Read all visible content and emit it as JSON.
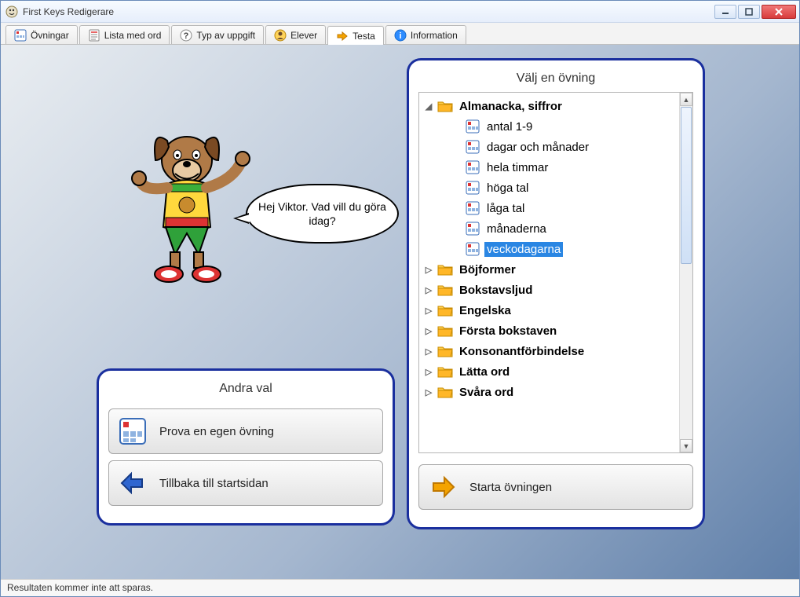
{
  "window": {
    "title": "First Keys Redigerare"
  },
  "tabs": [
    {
      "label": "Övningar"
    },
    {
      "label": "Lista med ord"
    },
    {
      "label": "Typ av uppgift"
    },
    {
      "label": "Elever"
    },
    {
      "label": "Testa"
    },
    {
      "label": "Information"
    }
  ],
  "active_tab_index": 4,
  "speech": "Hej Viktor. Vad vill du göra idag?",
  "left_panel": {
    "title": "Andra val",
    "try_own": "Prova en egen övning",
    "back_home": "Tillbaka till startsidan"
  },
  "right_panel": {
    "title": "Välj en övning",
    "start_button": "Starta övningen"
  },
  "tree": {
    "expanded_folder": "Almanacka, siffror",
    "children": [
      "antal 1-9",
      "dagar och månader",
      "hela timmar",
      "höga tal",
      "låga tal",
      "månaderna",
      "veckodagarna"
    ],
    "selected_child_index": 6,
    "collapsed_folders": [
      "Böjformer",
      "Bokstavsljud",
      "Engelska",
      "Första bokstaven",
      "Konsonantförbindelse",
      "Lätta ord",
      "Svåra ord"
    ]
  },
  "statusbar": "Resultaten kommer inte att sparas."
}
